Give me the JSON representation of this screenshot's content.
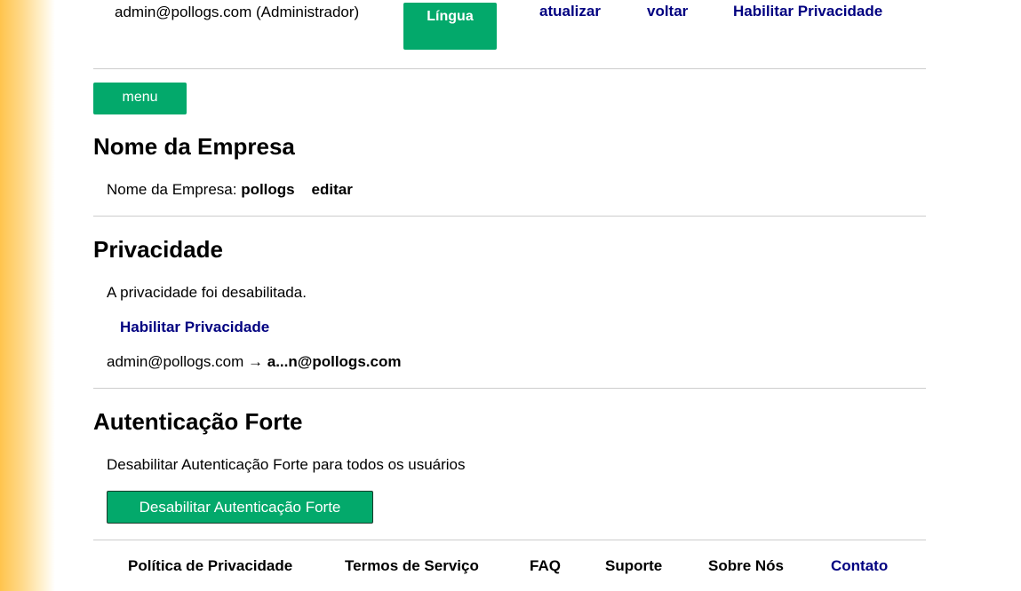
{
  "header": {
    "user": "admin@pollogs.com (Administrador)",
    "language_button": "Língua",
    "links": {
      "refresh": "atualizar",
      "back": "voltar",
      "enable_privacy": "Habilitar Privacidade"
    }
  },
  "menu_button": "menu",
  "company": {
    "heading": "Nome da Empresa",
    "label": "Nome da Empresa:",
    "value": "pollogs",
    "edit": "editar"
  },
  "privacy": {
    "heading": "Privacidade",
    "status": "A privacidade foi desabilitada.",
    "enable_link": "Habilitar Privacidade",
    "email_from": "admin@pollogs.com",
    "arrow": "→",
    "email_to": "a...n@pollogs.com"
  },
  "strong_auth": {
    "heading": "Autenticação Forte",
    "description": "Desabilitar Autenticação Forte para todos os usuários",
    "button": "Desabilitar Autenticação Forte"
  },
  "footer": {
    "privacy_policy": "Política de Privacidade",
    "terms": "Termos de Serviço",
    "faq": "FAQ",
    "support": "Suporte",
    "about": "Sobre Nós",
    "contact": "Contato"
  },
  "colors": {
    "accent_green": "#03a96b",
    "link_navy": "#000080",
    "divider": "#cccccc"
  }
}
